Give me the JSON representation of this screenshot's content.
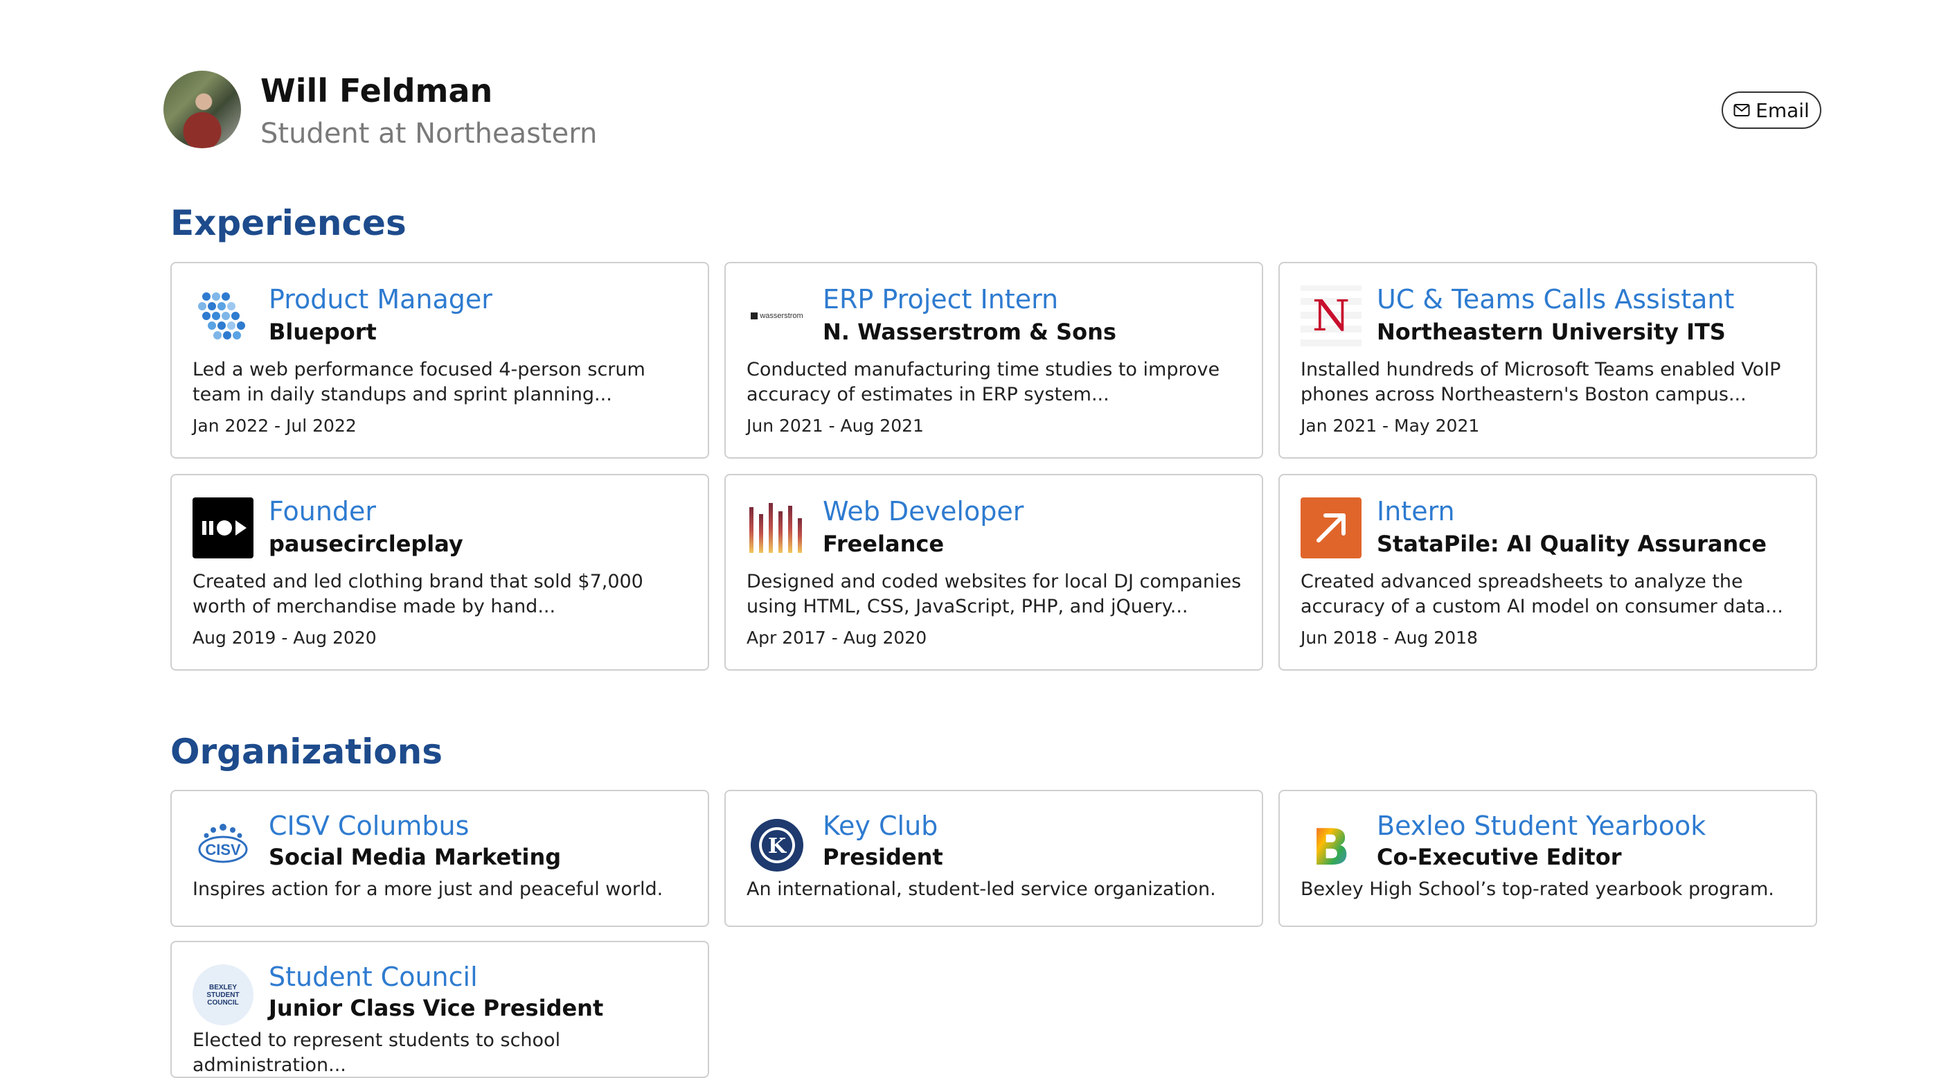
{
  "profile": {
    "name": "Will Feldman",
    "tagline": "Student at Northeastern",
    "email_label": "Email"
  },
  "experiences": {
    "title": "Experiences",
    "items": [
      {
        "title": "Product Manager",
        "company": "Blueport",
        "description": "Led a web performance focused 4-person scrum team in daily standups and sprint planning...",
        "dates": "Jan 2022 - Jul 2022",
        "logo": "blueport-logo"
      },
      {
        "title": "ERP Project Intern",
        "company": "N. Wasserstrom & Sons",
        "description": "Conducted manufacturing time studies to improve accuracy of estimates in ERP system...",
        "dates": "Jun 2021 - Aug 2021",
        "logo": "wasserstrom-logo",
        "logo_text": "wasserstrom"
      },
      {
        "title": "UC & Teams Calls Assistant",
        "company": "Northeastern University ITS",
        "description": "Installed hundreds of Microsoft Teams enabled VoIP phones across Northeastern's Boston campus...",
        "dates": "Jan 2021 - May 2021",
        "logo": "northeastern-logo",
        "logo_text": "N"
      },
      {
        "title": "Founder",
        "company": "pausecircleplay",
        "description": "Created and led clothing brand that sold $7,000 worth of merchandise made by hand...",
        "dates": "Aug 2019 - Aug 2020",
        "logo": "pausecircleplay-logo"
      },
      {
        "title": "Web Developer",
        "company": "Freelance",
        "description": "Designed and coded websites for local DJ companies using HTML, CSS, JavaScript, PHP, and jQuery...",
        "dates": "Apr 2017 - Aug 2020",
        "logo": "equalizer-logo"
      },
      {
        "title": "Intern",
        "company": "StataPile: AI Quality Assurance",
        "description": "Created advanced spreadsheets to analyze the accuracy of a custom AI model on consumer data...",
        "dates": "Jun 2018 - Aug 2018",
        "logo": "statapile-logo"
      }
    ]
  },
  "organizations": {
    "title": "Organizations",
    "items": [
      {
        "title": "CISV Columbus",
        "role": "Social Media Marketing",
        "description": "Inspires action for a more just and peaceful world.",
        "logo": "cisv-logo",
        "logo_text": "CISV"
      },
      {
        "title": "Key Club",
        "role": "President",
        "description": "An international, student-led service organization.",
        "logo": "key-club-logo",
        "logo_text": "K"
      },
      {
        "title": "Bexleo Student Yearbook",
        "role": "Co-Executive Editor",
        "description": "Bexley High School’s top-rated yearbook program.",
        "logo": "bexleo-logo",
        "logo_text": "B"
      },
      {
        "title": "Student Council",
        "role": "Junior Class Vice President",
        "description": "Elected to represent students to school administration...",
        "logo": "student-council-logo",
        "logo_text": "BEXLEY STUDENT COUNCIL"
      }
    ]
  },
  "colors": {
    "section_title": "#1d4b8c",
    "card_title": "#2e7bd0",
    "card_border": "#cfcfcf",
    "tagline": "#7a7a7a",
    "statapile_orange": "#e0652b"
  }
}
